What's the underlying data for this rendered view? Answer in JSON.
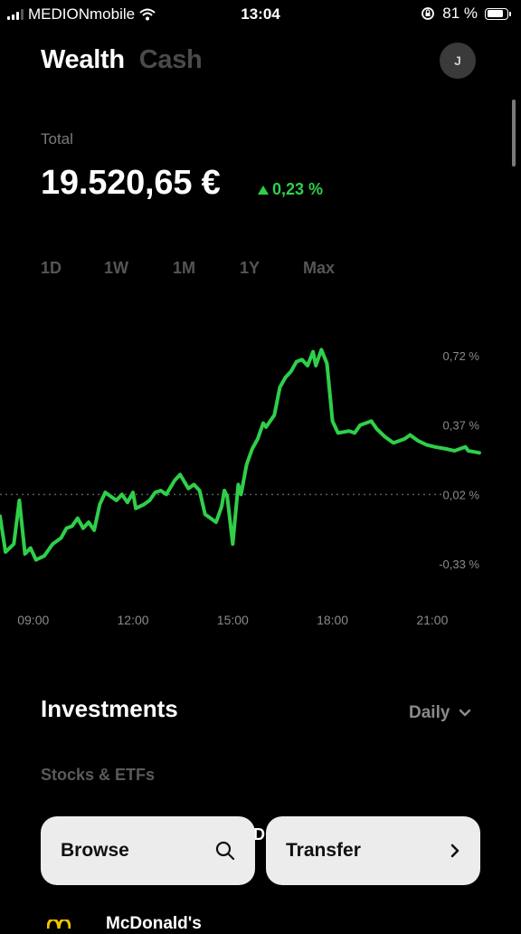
{
  "status_bar": {
    "carrier": "MEDIONmobile",
    "time": "13:04",
    "battery": "81 %",
    "battery_level": 0.81
  },
  "header": {
    "tab_active": "Wealth",
    "tab_inactive": "Cash",
    "avatar_initial": "J"
  },
  "total": {
    "label": "Total",
    "value": "19.520,65 €",
    "change": "0,23 %"
  },
  "ranges": [
    "1D",
    "1W",
    "1M",
    "1Y",
    "Max"
  ],
  "active_range": "1D",
  "chart_data": {
    "type": "line",
    "line_color": "#2fcf4a",
    "yticks": [
      "0,72 %",
      "0,37 %",
      "0,02 %",
      "-0,33 %"
    ],
    "xticks": [
      "09:00",
      "12:00",
      "15:00",
      "18:00",
      "21:00"
    ],
    "baseline": 0.02,
    "ylim": [
      -0.33,
      0.72
    ],
    "x_range": [
      "08:00",
      "22:30"
    ],
    "series": [
      {
        "points": [
          [
            "08:00",
            -0.09
          ],
          [
            "08:10",
            -0.27
          ],
          [
            "08:25",
            -0.23
          ],
          [
            "08:35",
            -0.01
          ],
          [
            "08:45",
            -0.28
          ],
          [
            "08:55",
            -0.25
          ],
          [
            "09:05",
            -0.31
          ],
          [
            "09:20",
            -0.29
          ],
          [
            "09:35",
            -0.23
          ],
          [
            "09:50",
            -0.2
          ],
          [
            "10:00",
            -0.15
          ],
          [
            "10:10",
            -0.14
          ],
          [
            "10:20",
            -0.1
          ],
          [
            "10:30",
            -0.15
          ],
          [
            "10:40",
            -0.12
          ],
          [
            "10:50",
            -0.16
          ],
          [
            "11:00",
            -0.03
          ],
          [
            "11:10",
            0.03
          ],
          [
            "11:20",
            0.01
          ],
          [
            "11:30",
            -0.01
          ],
          [
            "11:40",
            0.02
          ],
          [
            "11:50",
            -0.02
          ],
          [
            "12:00",
            0.03
          ],
          [
            "12:05",
            -0.05
          ],
          [
            "12:20",
            -0.03
          ],
          [
            "12:30",
            -0.01
          ],
          [
            "12:40",
            0.03
          ],
          [
            "12:50",
            0.04
          ],
          [
            "13:00",
            0.02
          ],
          [
            "13:15",
            0.09
          ],
          [
            "13:25",
            0.12
          ],
          [
            "13:40",
            0.05
          ],
          [
            "13:50",
            0.07
          ],
          [
            "14:00",
            0.04
          ],
          [
            "14:10",
            -0.08
          ],
          [
            "14:20",
            -0.1
          ],
          [
            "14:30",
            -0.12
          ],
          [
            "14:40",
            -0.04
          ],
          [
            "14:45",
            0.04
          ],
          [
            "14:50",
            0.01
          ],
          [
            "15:00",
            -0.23
          ],
          [
            "15:10",
            0.07
          ],
          [
            "15:15",
            0.02
          ],
          [
            "15:25",
            0.17
          ],
          [
            "15:35",
            0.25
          ],
          [
            "15:45",
            0.3
          ],
          [
            "15:55",
            0.38
          ],
          [
            "16:00",
            0.36
          ],
          [
            "16:15",
            0.42
          ],
          [
            "16:25",
            0.56
          ],
          [
            "16:35",
            0.61
          ],
          [
            "16:45",
            0.64
          ],
          [
            "16:55",
            0.69
          ],
          [
            "17:05",
            0.7
          ],
          [
            "17:15",
            0.67
          ],
          [
            "17:25",
            0.74
          ],
          [
            "17:30",
            0.67
          ],
          [
            "17:40",
            0.75
          ],
          [
            "17:50",
            0.68
          ],
          [
            "18:00",
            0.39
          ],
          [
            "18:10",
            0.33
          ],
          [
            "18:30",
            0.34
          ],
          [
            "18:40",
            0.33
          ],
          [
            "18:50",
            0.37
          ],
          [
            "19:10",
            0.39
          ],
          [
            "19:20",
            0.35
          ],
          [
            "19:35",
            0.31
          ],
          [
            "19:50",
            0.28
          ],
          [
            "20:10",
            0.3
          ],
          [
            "20:20",
            0.32
          ],
          [
            "20:35",
            0.29
          ],
          [
            "20:50",
            0.27
          ],
          [
            "21:05",
            0.26
          ],
          [
            "21:25",
            0.25
          ],
          [
            "21:40",
            0.24
          ],
          [
            "22:00",
            0.26
          ],
          [
            "22:05",
            0.24
          ],
          [
            "22:25",
            0.23
          ]
        ]
      }
    ]
  },
  "investments": {
    "title": "Investments",
    "sort_label": "Daily",
    "section_label": "Stocks & ETFs"
  },
  "actions": {
    "browse_label": "Browse",
    "transfer_label": "Transfer"
  },
  "partial_item": {
    "name": "McDonald's"
  }
}
